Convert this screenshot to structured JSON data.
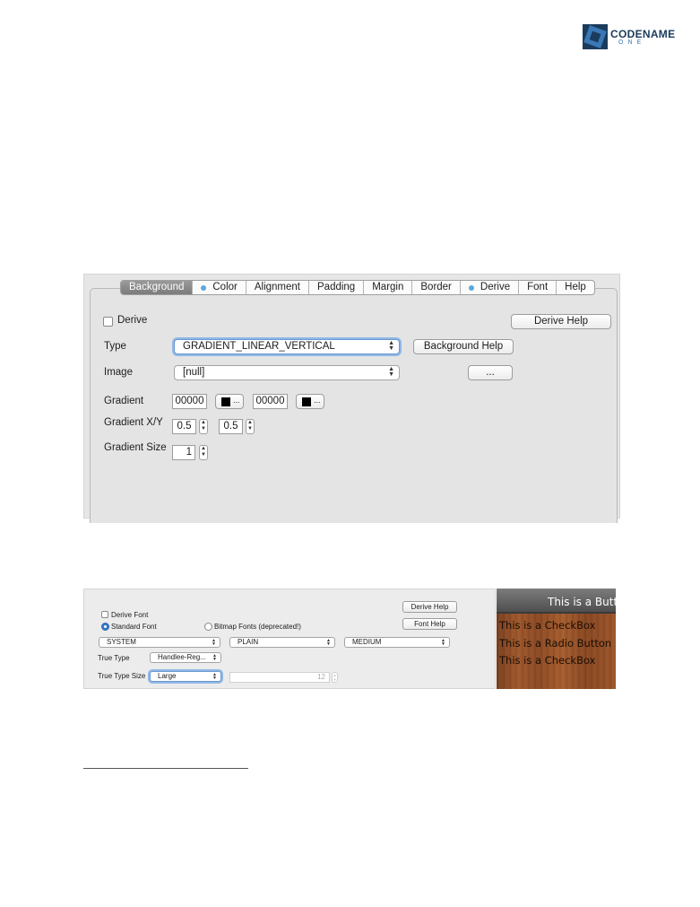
{
  "logo": {
    "word": "CODENAME",
    "sub": "ONE",
    "colors": {
      "dark": "#1a3b5c",
      "accent": "#3a78b5"
    }
  },
  "style_editor": {
    "tabs": [
      {
        "label": "Background",
        "active": true,
        "dot": false
      },
      {
        "label": "Color",
        "active": false,
        "dot": true
      },
      {
        "label": "Alignment",
        "active": false,
        "dot": false
      },
      {
        "label": "Padding",
        "active": false,
        "dot": false
      },
      {
        "label": "Margin",
        "active": false,
        "dot": false
      },
      {
        "label": "Border",
        "active": false,
        "dot": false
      },
      {
        "label": "Derive",
        "active": false,
        "dot": true
      },
      {
        "label": "Font",
        "active": false,
        "dot": false
      },
      {
        "label": "Help",
        "active": false,
        "dot": false
      }
    ],
    "derive_label": "Derive",
    "derive_checked": false,
    "derive_help": "Derive Help",
    "type_label": "Type",
    "type_value": "GRADIENT_LINEAR_VERTICAL",
    "background_help": "Background Help",
    "image_label": "Image",
    "image_value": "[null]",
    "image_browse": "...",
    "gradient_label": "Gradient",
    "gradient_start": "00000",
    "gradient_end": "00000",
    "color_button_ellipsis": "...",
    "gradient_xy_label": "Gradient X/Y",
    "gradient_x": "0.5",
    "gradient_y": "0.5",
    "gradient_size_label": "Gradient Size",
    "gradient_size": "1",
    "swatch_color": "#000000"
  },
  "font_editor": {
    "derive_font": "Derive Font",
    "derive_help": "Derive Help",
    "standard_font": "Standard Font",
    "bitmap_fonts": "Bitmap Fonts (deprecated!)",
    "font_help": "Font Help",
    "family": "SYSTEM",
    "style": "PLAIN",
    "size": "MEDIUM",
    "true_type_label": "True Type",
    "true_type_value": "Handlee-Reg...",
    "true_type_size_label": "True Type Size",
    "true_type_size_value": "Large",
    "size_number": "12"
  },
  "preview": {
    "button": "This is a Button",
    "lines": [
      "This is a CheckBox",
      "This is a Radio Button",
      "This is a CheckBox"
    ]
  }
}
